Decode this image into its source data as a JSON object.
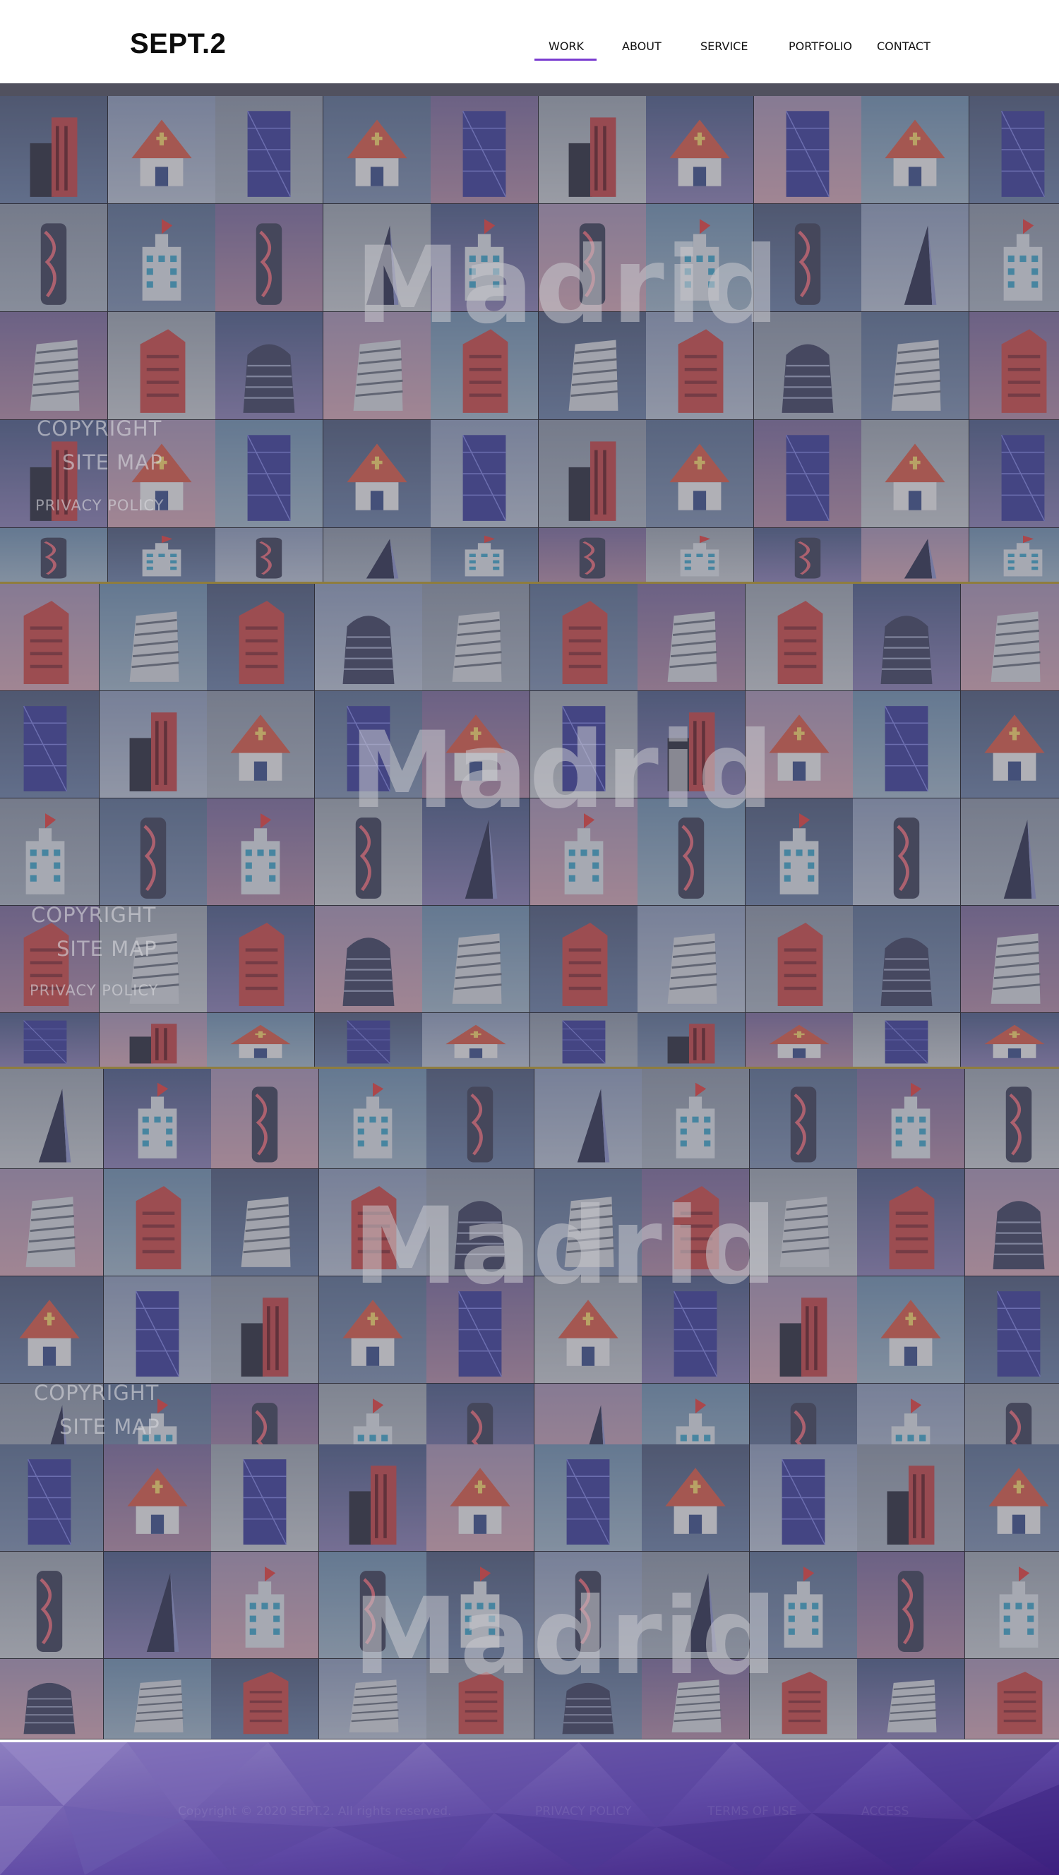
{
  "brand": {
    "logo": "SEPT.2"
  },
  "nav": {
    "items": [
      {
        "label": "WORK",
        "active": true
      },
      {
        "label": "ABOUT",
        "active": false
      },
      {
        "label": "SERVICE",
        "active": false
      },
      {
        "label": "PORTFOLIO",
        "active": false
      },
      {
        "label": "CONTACT",
        "active": false
      }
    ],
    "active_color": "#7a3cd0"
  },
  "hero": {
    "city": "Madrid",
    "links": {
      "copyright": "COPYRIGHT",
      "site_map": "SITE MAP",
      "privacy_policy": "PRIVACY POLICY"
    }
  },
  "tile_icons": [
    "hospital-icon",
    "church-icon",
    "skyscraper-icon",
    "twisted-tower-icon",
    "glass-tower-icon",
    "red-tower-icon",
    "spire-tower-icon",
    "office-block-icon",
    "residential-tower-icon",
    "needle-tower-icon",
    "city-hall-icon",
    "spiral-tower-icon",
    "museum-icon",
    "stadium-icon",
    "bank-icon"
  ],
  "footer": {
    "copyright": "Copyright © 2020 SEPT.2. All rights reserved.",
    "links": [
      "PRIVACY POLICY",
      "TERMS OF USE",
      "ACCESS"
    ]
  },
  "colors": {
    "overlay": "#55555f",
    "footer_gradient": [
      "#8d7fc0",
      "#4a2a8a"
    ],
    "separator": "#8f7d3e"
  }
}
